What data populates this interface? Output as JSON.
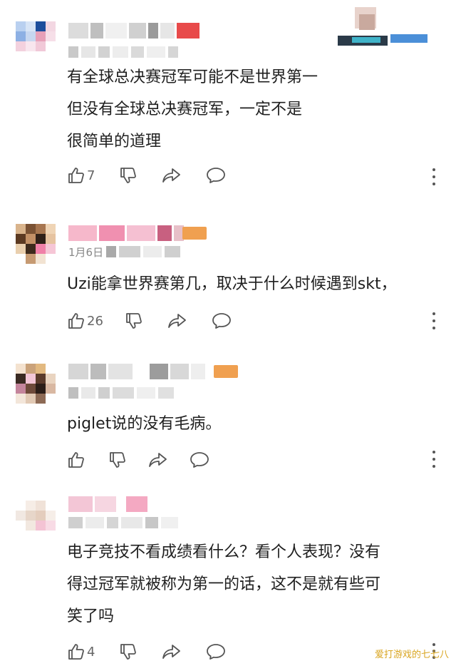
{
  "comments": [
    {
      "lines": [
        "有全球总决赛冠军可能不是世界第一",
        "但没有全球总决赛冠军，一定不是",
        "很简单的道理"
      ],
      "likes": "7",
      "date": ""
    },
    {
      "lines": [
        "Uzi能拿世界赛第几，取决于什么时候遇到skt，"
      ],
      "likes": "26",
      "date": "1月6日"
    },
    {
      "lines": [
        "piglet说的没有毛病。"
      ],
      "likes": "",
      "date": ""
    },
    {
      "lines": [
        "电子竞技不看成绩看什么？看个人表现？没有",
        "得过冠军就被称为第一的话，这不是就有些可",
        "笑了吗"
      ],
      "likes": "4",
      "date": ""
    }
  ],
  "watermark": "爱打游戏的七七八",
  "icons": {
    "like": "thumbs-up-icon",
    "dislike": "thumbs-down-icon",
    "share": "share-icon",
    "reply": "comment-bubble-icon",
    "more": "more-vertical-icon"
  },
  "colors": {
    "text": "#1f1f1f",
    "meta": "#888888",
    "icon": "#555555",
    "watermark": "#d9a520"
  }
}
